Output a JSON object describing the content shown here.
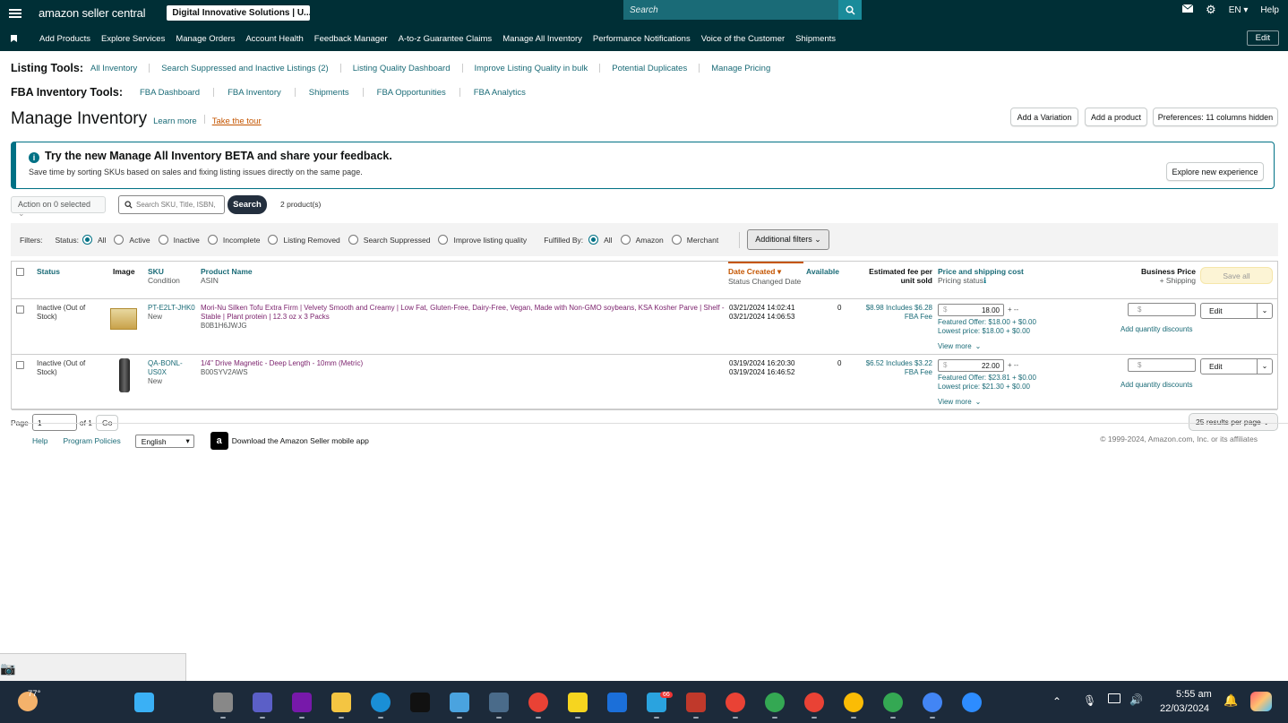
{
  "topbar": {
    "logo_text": "amazon seller central",
    "account": "Digital Innovative Solutions | U...",
    "search_placeholder": "Search",
    "language": "EN",
    "help": "Help"
  },
  "nav": {
    "items": [
      "Add Products",
      "Explore Services",
      "Manage Orders",
      "Account Health",
      "Feedback Manager",
      "A-to-z Guarantee Claims",
      "Manage All Inventory",
      "Performance Notifications",
      "Voice of the Customer",
      "Shipments"
    ],
    "edit": "Edit"
  },
  "listing_tools": {
    "label": "Listing Tools:",
    "links": [
      "All Inventory",
      "Search Suppressed and Inactive Listings (2)",
      "Listing Quality Dashboard",
      "Improve Listing Quality in bulk",
      "Potential Duplicates",
      "Manage Pricing"
    ]
  },
  "fba_tools": {
    "label": "FBA Inventory Tools:",
    "links": [
      "FBA Dashboard",
      "FBA Inventory",
      "Shipments",
      "FBA Opportunities",
      "FBA Analytics"
    ]
  },
  "page": {
    "title": "Manage Inventory",
    "learn_more": "Learn more",
    "tour": "Take the tour",
    "btn_variation": "Add a Variation",
    "btn_product": "Add a product",
    "btn_prefs": "Preferences: 11 columns hidden"
  },
  "banner": {
    "heading": "Try the new Manage All Inventory BETA and share your feedback.",
    "desc": "Save time by sorting SKUs based on sales and fixing listing issues directly on the same page.",
    "button": "Explore new experience"
  },
  "toolbar": {
    "action": "Action on 0 selected",
    "search_placeholder": "Search SKU, Title, ISBN,",
    "search_btn": "Search",
    "count": "2 product(s)"
  },
  "filters": {
    "label": "Filters:",
    "status_label": "Status:",
    "status": [
      "All",
      "Active",
      "Inactive",
      "Incomplete",
      "Listing Removed",
      "Search Suppressed",
      "Improve listing quality"
    ],
    "fulfilled_label": "Fulfilled By:",
    "fulfilled": [
      "All",
      "Amazon",
      "Merchant"
    ],
    "additional": "Additional filters"
  },
  "columns": {
    "status": "Status",
    "image": "Image",
    "sku": "SKU",
    "condition": "Condition",
    "product": "Product Name",
    "asin": "ASIN",
    "date": "Date Created",
    "status_date": "Status Changed Date",
    "available": "Available",
    "fee": "Estimated fee per unit sold",
    "price": "Price and shipping cost",
    "pricing_status": "Pricing status",
    "business": "Business Price",
    "shipping": "+ Shipping",
    "save_all": "Save all"
  },
  "rows": [
    {
      "status": "Inactive (Out of Stock)",
      "sku": "PT-E2LT-JHK0",
      "condition": "New",
      "name": "Mori-Nu Silken Tofu Extra Firm | Velvety Smooth and Creamy | Low Fat, Gluten-Free, Dairy-Free, Vegan, Made with Non-GMO soybeans, KSA Kosher Parve | Shelf -Stable | Plant protein | 12.3 oz x 3 Packs",
      "asin": "B0B1H6JWJG",
      "date": "03/21/2024 14:02:41",
      "date2": "03/21/2024 14:06:53",
      "available": "0",
      "fee": "$8.98 Includes $6.28 FBA Fee",
      "price": "18.00",
      "featured": "Featured Offer: $18.00 + $0.00",
      "lowest": "Lowest price: $18.00 + $0.00",
      "view_more": "View more",
      "qty": "Add quantity discounts",
      "edit": "Edit"
    },
    {
      "status": "Inactive (Out of Stock)",
      "sku": "QA-BONL-US0X",
      "condition": "New",
      "name": "1/4\" Drive Magnetic - Deep Length - 10mm (Metric)",
      "asin": "B00SYV2AWS",
      "date": "03/19/2024 16:20:30",
      "date2": "03/19/2024 16:46:52",
      "available": "0",
      "fee": "$6.52 Includes $3.22 FBA Fee",
      "price": "22.00",
      "featured": "Featured Offer: $23.81 + $0.00",
      "lowest": "Lowest price: $21.30 + $0.00",
      "view_more": "View more",
      "qty": "Add quantity discounts",
      "edit": "Edit"
    }
  ],
  "pager": {
    "page": "Page",
    "value": "1",
    "of": "of 1",
    "go": "Go",
    "per_page": "25 results per page"
  },
  "footer": {
    "help": "Help",
    "policies": "Program Policies",
    "language": "English",
    "app": "Download the Amazon Seller mobile app",
    "copyright": "© 1999-2024, Amazon.com, Inc. or its affiliates"
  },
  "taskbar": {
    "weather": "77°",
    "time": "5:55 am",
    "date": "22/03/2024",
    "badge": "66"
  }
}
